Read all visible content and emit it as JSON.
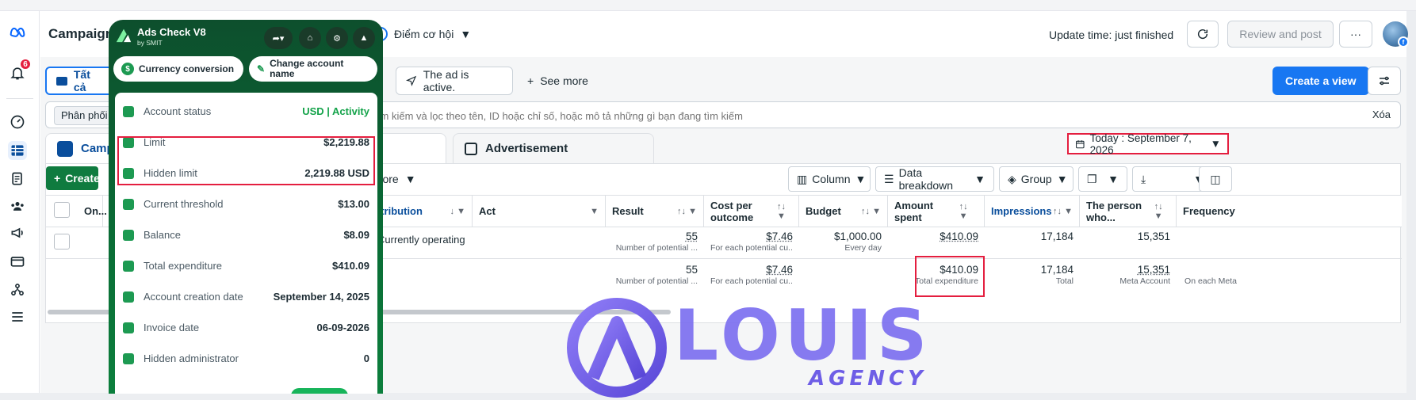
{
  "header": {
    "title": "Campaign",
    "opportunity": "Điểm cơ hội",
    "update_time": "Update time: just finished",
    "review_label": "Review and post",
    "more_label": "···"
  },
  "rail": {
    "notification_count": "6"
  },
  "filters": {
    "all_label": "Tất cả",
    "active_label": "The ad is active.",
    "see_more": "See more",
    "create_view": "Create a view"
  },
  "search": {
    "pill": "Phân phối",
    "placeholder": "Tìm kiếm và lọc theo tên, ID hoặc chỉ số, hoặc mô tả những gì bạn đang tìm kiếm",
    "clear": "Xóa"
  },
  "tabs": {
    "campaign": "Campaign",
    "ad": "Advertisement",
    "date": "Today : September 7, 2026"
  },
  "toolbar": {
    "create": "Create",
    "see_more": "See more",
    "column": "Column",
    "breakdown": "Data breakdown",
    "group": "Group"
  },
  "table": {
    "headers": {
      "on": "On...",
      "distribution": "Distribution",
      "act": "Act",
      "result": "Result",
      "cost": "Cost per outcome",
      "budget": "Budget",
      "amount": "Amount spent",
      "impressions": "Impressions",
      "person": "The person who...",
      "frequency": "Frequency"
    },
    "row1": {
      "distribution": "Currently operating",
      "result": "55",
      "result_sub": "Number of potential ...",
      "cost": "$7.46",
      "cost_sub": "For each potential cu...",
      "budget": "$1,000.00",
      "budget_sub": "Every day",
      "amount": "$410.09",
      "impressions": "17,184",
      "person": "15,351"
    },
    "row2": {
      "result": "55",
      "result_sub": "Number of potential ...",
      "cost": "$7.46",
      "cost_sub": "For each potential cu...",
      "amount": "$410.09",
      "amount_sub": "Total expenditure",
      "impressions": "17,184",
      "impressions_sub": "Total",
      "person": "15,351",
      "person_sub": "Meta Account",
      "frequency_sub": "On each Meta"
    }
  },
  "panel": {
    "title": "Ads Check V8",
    "subtitle": "by SMIT",
    "currency_btn": "Currency conversion",
    "rename_btn": "Change account name",
    "rows": [
      {
        "label": "Account status",
        "value": "USD | Activity"
      },
      {
        "label": "Limit",
        "value": "$2,219.88"
      },
      {
        "label": "Hidden limit",
        "value": "2,219.88 USD"
      },
      {
        "label": "Current threshold",
        "value": "$13.00"
      },
      {
        "label": "Balance",
        "value": "$8.09"
      },
      {
        "label": "Total expenditure",
        "value": "$410.09"
      },
      {
        "label": "Account creation date",
        "value": "September 14, 2025"
      },
      {
        "label": "Invoice date",
        "value": "06-09-2026"
      },
      {
        "label": "Hidden administrator",
        "value": "0"
      }
    ]
  },
  "watermark": {
    "name": "LOUIS",
    "sub": "AGENCY"
  },
  "colors": {
    "brand_blue": "#1877f2",
    "panel_green": "#0a6b35",
    "highlight_red": "#e41e3f"
  }
}
